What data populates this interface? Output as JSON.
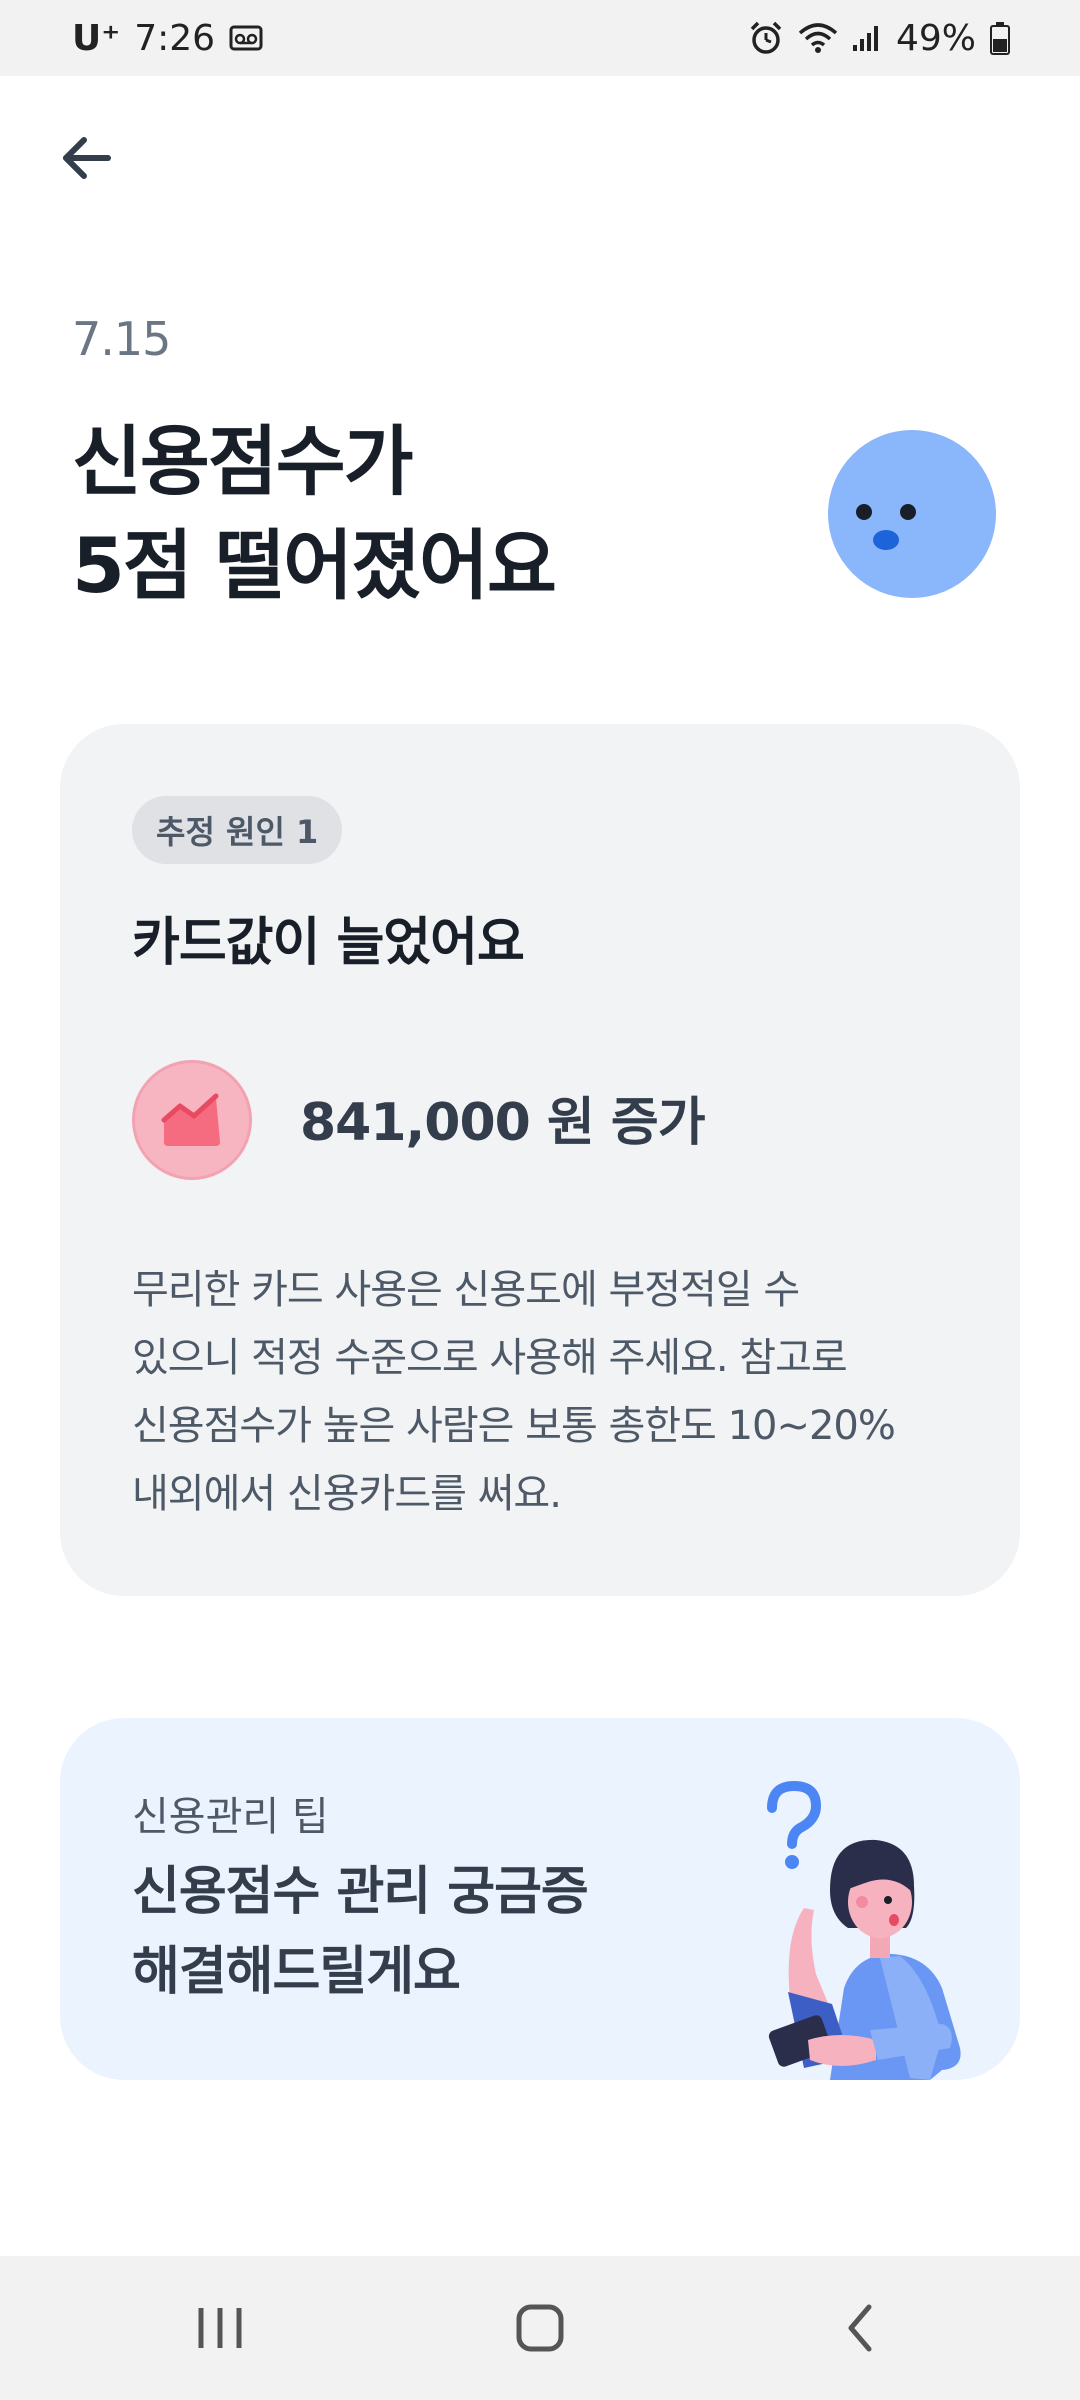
{
  "status_bar": {
    "carrier": "U⁺",
    "time": "7:26",
    "battery": "49%",
    "icons": [
      "voicemail-icon",
      "alarm-icon",
      "wifi-icon",
      "signal-icon",
      "battery-icon"
    ]
  },
  "header": {
    "back_icon": "arrow-left-icon"
  },
  "hero": {
    "date": "7.15",
    "title_line1": "신용점수가",
    "title_line2": "5점 떨어졌어요",
    "face_icon": "sad-face-icon",
    "face_color": "#8ab6fb"
  },
  "cause": {
    "badge": "추정 원인 1",
    "title": "카드값이 늘었어요",
    "trend_icon": "trending-up-chart-icon",
    "trend_color": "#f56b80",
    "amount": "841,000 원 증가",
    "desc_lines": [
      "무리한 카드 사용은 신용도에 부정적일 수",
      "있으니 적정 수준으로 사용해 주세요. 참고로",
      "신용점수가 높은 사람은 보통 총한도 10~20%",
      "내외에서 신용카드를 써요."
    ]
  },
  "tip": {
    "kicker": "신용관리 팁",
    "title_line1": "신용점수 관리 궁금증",
    "title_line2": "해결해드릴게요",
    "illustration": "woman-question-phone-illustration"
  },
  "nav": {
    "icons": [
      "recent-apps-icon",
      "home-icon",
      "back-icon"
    ]
  }
}
